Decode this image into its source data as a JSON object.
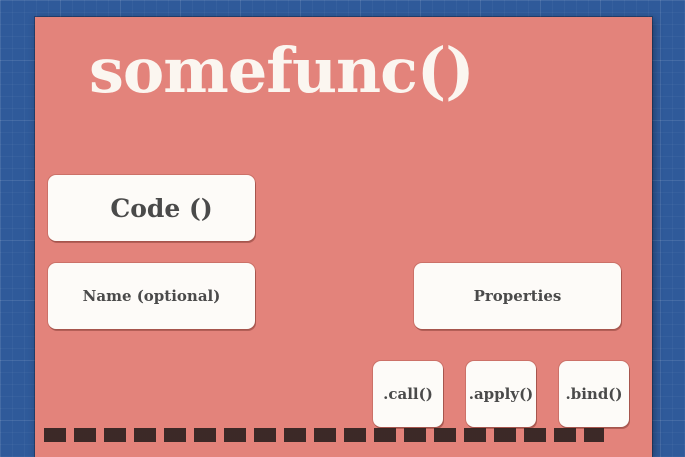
{
  "title": "somefunc()",
  "cards": {
    "code": "Code ()",
    "name": "Name (optional)",
    "properties": "Properties",
    "call": ".call()",
    "apply": ".apply()",
    "bind": ".bind()"
  }
}
